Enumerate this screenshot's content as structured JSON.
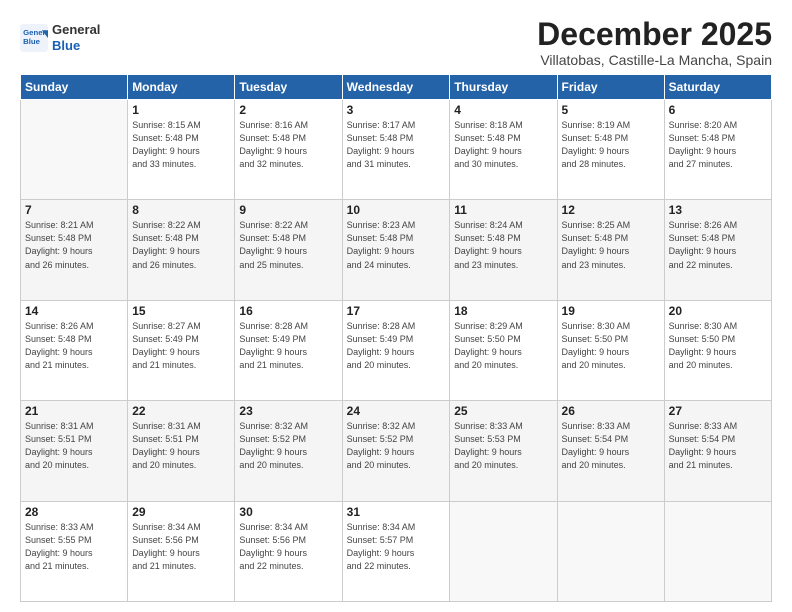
{
  "header": {
    "logo_line1": "General",
    "logo_line2": "Blue",
    "month": "December 2025",
    "location": "Villatobas, Castille-La Mancha, Spain"
  },
  "days_of_week": [
    "Sunday",
    "Monday",
    "Tuesday",
    "Wednesday",
    "Thursday",
    "Friday",
    "Saturday"
  ],
  "weeks": [
    [
      {
        "day": "",
        "info": ""
      },
      {
        "day": "1",
        "info": "Sunrise: 8:15 AM\nSunset: 5:48 PM\nDaylight: 9 hours\nand 33 minutes."
      },
      {
        "day": "2",
        "info": "Sunrise: 8:16 AM\nSunset: 5:48 PM\nDaylight: 9 hours\nand 32 minutes."
      },
      {
        "day": "3",
        "info": "Sunrise: 8:17 AM\nSunset: 5:48 PM\nDaylight: 9 hours\nand 31 minutes."
      },
      {
        "day": "4",
        "info": "Sunrise: 8:18 AM\nSunset: 5:48 PM\nDaylight: 9 hours\nand 30 minutes."
      },
      {
        "day": "5",
        "info": "Sunrise: 8:19 AM\nSunset: 5:48 PM\nDaylight: 9 hours\nand 28 minutes."
      },
      {
        "day": "6",
        "info": "Sunrise: 8:20 AM\nSunset: 5:48 PM\nDaylight: 9 hours\nand 27 minutes."
      }
    ],
    [
      {
        "day": "7",
        "info": "Sunrise: 8:21 AM\nSunset: 5:48 PM\nDaylight: 9 hours\nand 26 minutes."
      },
      {
        "day": "8",
        "info": "Sunrise: 8:22 AM\nSunset: 5:48 PM\nDaylight: 9 hours\nand 26 minutes."
      },
      {
        "day": "9",
        "info": "Sunrise: 8:22 AM\nSunset: 5:48 PM\nDaylight: 9 hours\nand 25 minutes."
      },
      {
        "day": "10",
        "info": "Sunrise: 8:23 AM\nSunset: 5:48 PM\nDaylight: 9 hours\nand 24 minutes."
      },
      {
        "day": "11",
        "info": "Sunrise: 8:24 AM\nSunset: 5:48 PM\nDaylight: 9 hours\nand 23 minutes."
      },
      {
        "day": "12",
        "info": "Sunrise: 8:25 AM\nSunset: 5:48 PM\nDaylight: 9 hours\nand 23 minutes."
      },
      {
        "day": "13",
        "info": "Sunrise: 8:26 AM\nSunset: 5:48 PM\nDaylight: 9 hours\nand 22 minutes."
      }
    ],
    [
      {
        "day": "14",
        "info": "Sunrise: 8:26 AM\nSunset: 5:48 PM\nDaylight: 9 hours\nand 21 minutes."
      },
      {
        "day": "15",
        "info": "Sunrise: 8:27 AM\nSunset: 5:49 PM\nDaylight: 9 hours\nand 21 minutes."
      },
      {
        "day": "16",
        "info": "Sunrise: 8:28 AM\nSunset: 5:49 PM\nDaylight: 9 hours\nand 21 minutes."
      },
      {
        "day": "17",
        "info": "Sunrise: 8:28 AM\nSunset: 5:49 PM\nDaylight: 9 hours\nand 20 minutes."
      },
      {
        "day": "18",
        "info": "Sunrise: 8:29 AM\nSunset: 5:50 PM\nDaylight: 9 hours\nand 20 minutes."
      },
      {
        "day": "19",
        "info": "Sunrise: 8:30 AM\nSunset: 5:50 PM\nDaylight: 9 hours\nand 20 minutes."
      },
      {
        "day": "20",
        "info": "Sunrise: 8:30 AM\nSunset: 5:50 PM\nDaylight: 9 hours\nand 20 minutes."
      }
    ],
    [
      {
        "day": "21",
        "info": "Sunrise: 8:31 AM\nSunset: 5:51 PM\nDaylight: 9 hours\nand 20 minutes."
      },
      {
        "day": "22",
        "info": "Sunrise: 8:31 AM\nSunset: 5:51 PM\nDaylight: 9 hours\nand 20 minutes."
      },
      {
        "day": "23",
        "info": "Sunrise: 8:32 AM\nSunset: 5:52 PM\nDaylight: 9 hours\nand 20 minutes."
      },
      {
        "day": "24",
        "info": "Sunrise: 8:32 AM\nSunset: 5:52 PM\nDaylight: 9 hours\nand 20 minutes."
      },
      {
        "day": "25",
        "info": "Sunrise: 8:33 AM\nSunset: 5:53 PM\nDaylight: 9 hours\nand 20 minutes."
      },
      {
        "day": "26",
        "info": "Sunrise: 8:33 AM\nSunset: 5:54 PM\nDaylight: 9 hours\nand 20 minutes."
      },
      {
        "day": "27",
        "info": "Sunrise: 8:33 AM\nSunset: 5:54 PM\nDaylight: 9 hours\nand 21 minutes."
      }
    ],
    [
      {
        "day": "28",
        "info": "Sunrise: 8:33 AM\nSunset: 5:55 PM\nDaylight: 9 hours\nand 21 minutes."
      },
      {
        "day": "29",
        "info": "Sunrise: 8:34 AM\nSunset: 5:56 PM\nDaylight: 9 hours\nand 21 minutes."
      },
      {
        "day": "30",
        "info": "Sunrise: 8:34 AM\nSunset: 5:56 PM\nDaylight: 9 hours\nand 22 minutes."
      },
      {
        "day": "31",
        "info": "Sunrise: 8:34 AM\nSunset: 5:57 PM\nDaylight: 9 hours\nand 22 minutes."
      },
      {
        "day": "",
        "info": ""
      },
      {
        "day": "",
        "info": ""
      },
      {
        "day": "",
        "info": ""
      }
    ]
  ]
}
